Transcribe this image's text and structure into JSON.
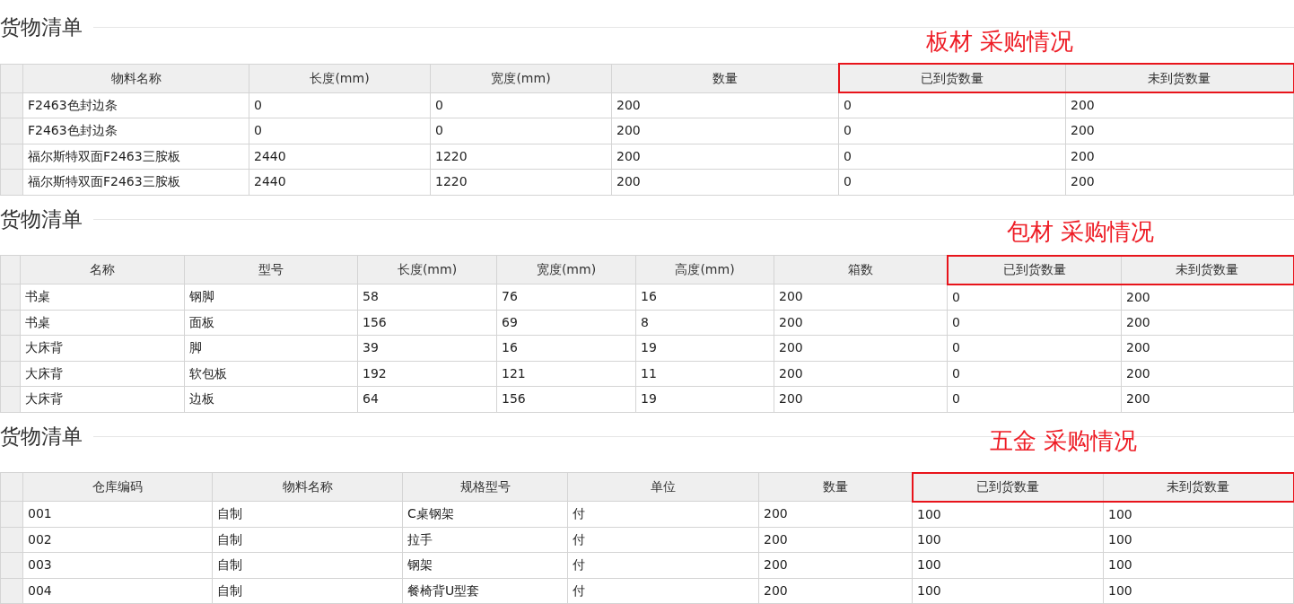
{
  "sections": [
    {
      "title": "货物清单",
      "annotation": "板材 采购情况",
      "table": {
        "columns": [
          {
            "label": "物料名称",
            "highlighted": false
          },
          {
            "label": "长度(mm)",
            "highlighted": false
          },
          {
            "label": "宽度(mm)",
            "highlighted": false
          },
          {
            "label": "数量",
            "highlighted": false
          },
          {
            "label": "已到货数量",
            "highlighted": true
          },
          {
            "label": "未到货数量",
            "highlighted": true
          }
        ],
        "rows": [
          [
            "F2463色封边条",
            "0",
            "0",
            "200",
            "0",
            "200"
          ],
          [
            "F2463色封边条",
            "0",
            "0",
            "200",
            "0",
            "200"
          ],
          [
            "福尔斯特双面F2463三胺板",
            "2440",
            "1220",
            "200",
            "0",
            "200"
          ],
          [
            "福尔斯特双面F2463三胺板",
            "2440",
            "1220",
            "200",
            "0",
            "200"
          ]
        ]
      }
    },
    {
      "title": "货物清单",
      "annotation": "包材 采购情况",
      "table": {
        "columns": [
          {
            "label": "名称",
            "highlighted": false
          },
          {
            "label": "型号",
            "highlighted": false
          },
          {
            "label": "长度(mm)",
            "highlighted": false
          },
          {
            "label": "宽度(mm)",
            "highlighted": false
          },
          {
            "label": "高度(mm)",
            "highlighted": false
          },
          {
            "label": "箱数",
            "highlighted": false
          },
          {
            "label": "已到货数量",
            "highlighted": true
          },
          {
            "label": "未到货数量",
            "highlighted": true
          }
        ],
        "rows": [
          [
            "书桌",
            "钢脚",
            "58",
            "76",
            "16",
            "200",
            "0",
            "200"
          ],
          [
            "书桌",
            "面板",
            "156",
            "69",
            "8",
            "200",
            "0",
            "200"
          ],
          [
            "大床背",
            "脚",
            "39",
            "16",
            "19",
            "200",
            "0",
            "200"
          ],
          [
            "大床背",
            "软包板",
            "192",
            "121",
            "11",
            "200",
            "0",
            "200"
          ],
          [
            "大床背",
            "边板",
            "64",
            "156",
            "19",
            "200",
            "0",
            "200"
          ]
        ]
      }
    },
    {
      "title": "货物清单",
      "annotation": "五金 采购情况",
      "table": {
        "columns": [
          {
            "label": "仓库编码",
            "highlighted": false
          },
          {
            "label": "物料名称",
            "highlighted": false
          },
          {
            "label": "规格型号",
            "highlighted": false
          },
          {
            "label": "单位",
            "highlighted": false
          },
          {
            "label": "数量",
            "highlighted": false
          },
          {
            "label": "已到货数量",
            "highlighted": true
          },
          {
            "label": "未到货数量",
            "highlighted": true
          }
        ],
        "rows": [
          [
            "001",
            "自制",
            "C桌钢架",
            "付",
            "200",
            "100",
            "100"
          ],
          [
            "002",
            "自制",
            "拉手",
            "付",
            "200",
            "100",
            "100"
          ],
          [
            "003",
            "自制",
            "钢架",
            "付",
            "200",
            "100",
            "100"
          ],
          [
            "004",
            "自制",
            "餐椅背U型套",
            "付",
            "200",
            "100",
            "100"
          ]
        ]
      }
    }
  ]
}
